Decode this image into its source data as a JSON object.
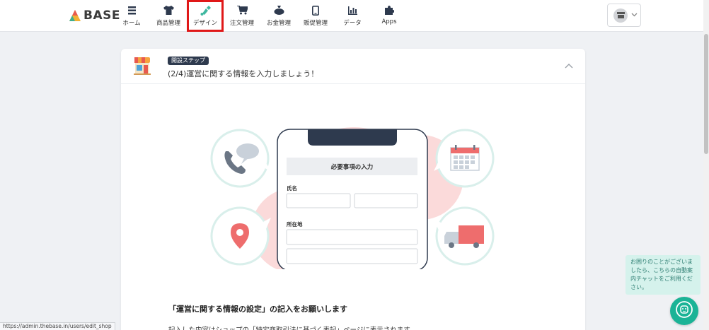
{
  "logo": {
    "text": "BASE"
  },
  "nav": [
    {
      "label": "ホーム",
      "icon": "list-icon"
    },
    {
      "label": "商品管理",
      "icon": "tshirt-icon"
    },
    {
      "label": "デザイン",
      "icon": "brush-icon",
      "active": true
    },
    {
      "label": "注文管理",
      "icon": "cart-icon"
    },
    {
      "label": "お金管理",
      "icon": "money-bag-icon"
    },
    {
      "label": "販促管理",
      "icon": "smartphone-icon"
    },
    {
      "label": "データ",
      "icon": "bar-chart-icon"
    },
    {
      "label": "Apps",
      "icon": "puzzle-icon"
    }
  ],
  "highlight_color": "#e01818",
  "card": {
    "badge": "開設ステップ",
    "title": "(2/4)運営に関する情報を入力しましょう！",
    "illustration": {
      "form_header": "必要事項の入力",
      "name_label": "氏名",
      "address_label": "所在地"
    },
    "section_title": "「運営に関する情報の設定」の記入をお願いします",
    "section_desc": "記入した内容はショップの「特定商取引法に基づく表記」ページに表示されます。"
  },
  "status_url": "https://admin.thebase.in/users/edit_shop",
  "chat": {
    "message": "お困りのことがございましたら、こちらの自動案内チャットをご利用ください。"
  }
}
